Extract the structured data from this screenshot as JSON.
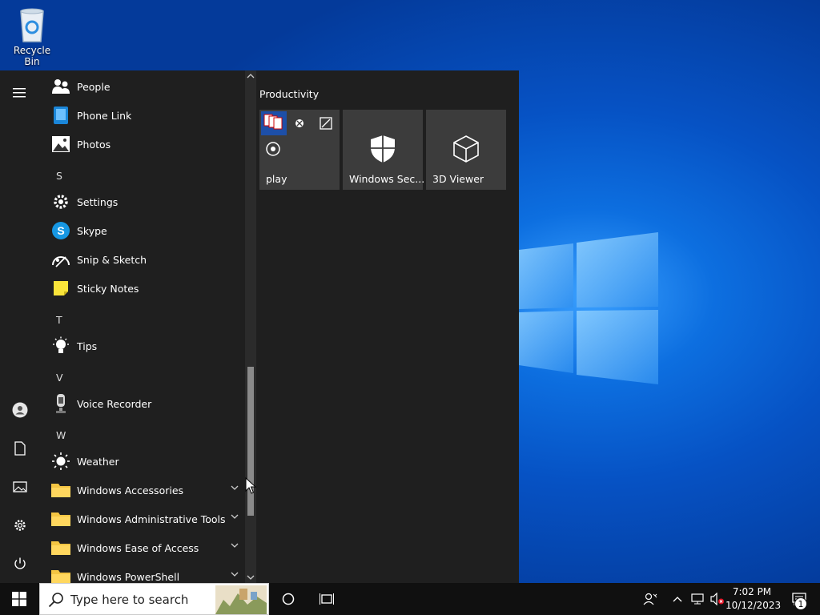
{
  "desktop": {
    "recycle_bin_label": "Recycle Bin"
  },
  "start_menu": {
    "rail": [
      "hamburger-menu-icon",
      "user-icon",
      "documents-icon",
      "pictures-icon",
      "settings-icon",
      "power-icon"
    ],
    "apps": [
      {
        "label": "People",
        "icon": "people-icon"
      },
      {
        "label": "Phone Link",
        "icon": "phone-link-icon"
      },
      {
        "label": "Photos",
        "icon": "photos-icon"
      },
      {
        "letter": "S"
      },
      {
        "label": "Settings",
        "icon": "settings-gear-icon"
      },
      {
        "label": "Skype",
        "icon": "skype-icon"
      },
      {
        "label": "Snip & Sketch",
        "icon": "snip-sketch-icon"
      },
      {
        "label": "Sticky Notes",
        "icon": "sticky-notes-icon"
      },
      {
        "letter": "T"
      },
      {
        "label": "Tips",
        "icon": "tips-bulb-icon"
      },
      {
        "letter": "V"
      },
      {
        "label": "Voice Recorder",
        "icon": "microphone-icon"
      },
      {
        "letter": "W"
      },
      {
        "label": "Weather",
        "icon": "sun-icon"
      },
      {
        "label": "Windows Accessories",
        "icon": "folder-icon",
        "expandable": true
      },
      {
        "label": "Windows Administrative Tools",
        "icon": "folder-icon",
        "expandable": true
      },
      {
        "label": "Windows Ease of Access",
        "icon": "folder-icon",
        "expandable": true
      },
      {
        "label": "Windows PowerShell",
        "icon": "folder-icon",
        "expandable": true
      }
    ],
    "tile_group": "Productivity",
    "tiles": [
      {
        "label": "play",
        "icon": "play-folder-icons"
      },
      {
        "label": "Windows Sec...",
        "icon": "shield-icon"
      },
      {
        "label": "3D Viewer",
        "icon": "cube-icon"
      }
    ]
  },
  "taskbar": {
    "search_placeholder": "Type here to search",
    "time": "7:02 PM",
    "date": "10/12/2023",
    "notification_count": "1"
  },
  "colors": {
    "start_bg": "#1f1f1f",
    "tile_bg": "#3c3c3c",
    "taskbar_bg": "#101010",
    "folder_yellow": "#f4c543"
  }
}
